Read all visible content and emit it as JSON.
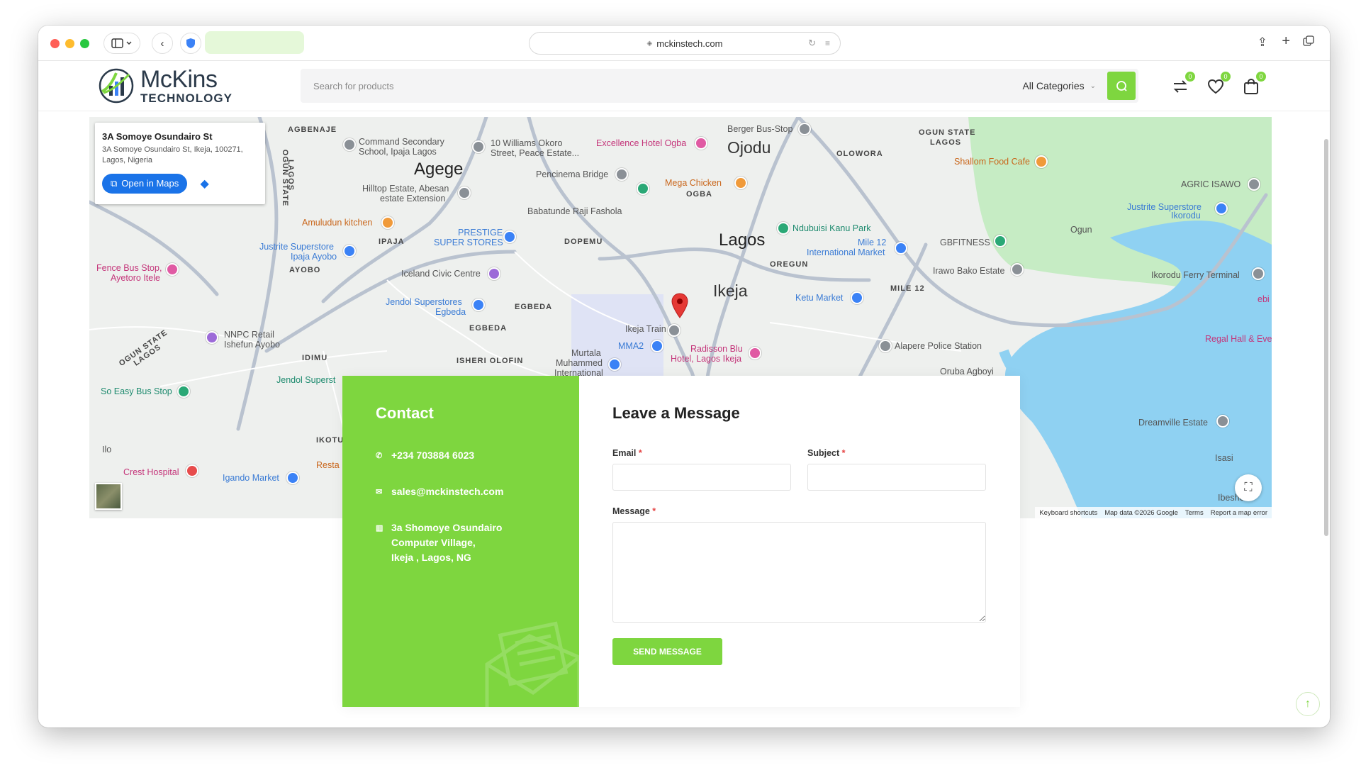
{
  "browser": {
    "url": "mckinstech.com"
  },
  "header": {
    "logo_word": "McKins",
    "logo_sub": "TECHNOLOGY",
    "search_placeholder": "Search for products",
    "category": "All Categories",
    "compare_count": "0",
    "wishlist_count": "0",
    "cart_count": "0"
  },
  "map": {
    "place_title": "3A Somoye Osundairo St",
    "place_address_line1": "3A Somoye Osundairo St, Ikeja, 100271,",
    "place_address_line2": "Lagos, Nigeria",
    "open_in_maps": "Open in Maps",
    "labels": {
      "agenaje": "AGBENAJE",
      "command": "Command Secondary",
      "command2": "School, Ipaja Lagos",
      "williams": "10 Williams Okoro",
      "williams2": "Street, Peace Estate...",
      "excellence": "Excellence Hotel Ogba",
      "berger": "Berger Bus-Stop",
      "ojodu": "Ojodu",
      "ogun_state": "OGUN STATE",
      "lagos_state": "LAGOS",
      "olowora": "OLOWORA",
      "shallom": "Shallom Food Cafe",
      "agege": "Agege",
      "pencinema": "Pencinema Bridge",
      "mega": "Mega Chicken",
      "ogba": "OGBA",
      "hilltop": "Hilltop Estate, Abesan",
      "hilltop2": "estate Extension",
      "babatunde": "Babatunde Raji Fashola",
      "agric": "AGRIC ISAWO",
      "justrite2": "Justrite Superstore",
      "justrite2b": "Ikorodu",
      "amuludun": "Amuludun kitchen",
      "ndubuisi": "Ndubuisi Kanu Park",
      "lagos": "Lagos",
      "prestige": "PRESTIGE",
      "prestige2": "SUPER STORES",
      "dopemu": "DOPEMU",
      "ipaja": "IPAJA",
      "ogun": "Ogun",
      "justrite": "Justrite Superstore",
      "justrite_b": "Ipaja Ayobo",
      "gbfitness": "GBFITNESS",
      "mile12market": "Mile 12",
      "intl_market": "International Market",
      "fence": "Fence Bus Stop,",
      "fence2": "Ayetoro Itele",
      "ayobo": "AYOBO",
      "iceland": "Iceland Civic Centre",
      "oregun": "OREGUN",
      "irawo": "Irawo Bako Estate",
      "ikorodu_ferry": "Ikorodu Ferry Terminal",
      "ikeja": "Ikeja",
      "ketu": "Ketu Market",
      "mile12": "MILE 12",
      "jendol": "Jendol Superstores",
      "jendol2": "Egbeda",
      "egbeda_caps": "EGBEDA",
      "egbeda": "EGBEDA",
      "ikeja_train": "Ikeja Train",
      "nnpc": "NNPC Retail",
      "nnpc2": "Ishefun Ayobo",
      "mma2": "MMA2",
      "regal": "Regal Hall & Eve",
      "alapere": "Alapere Police Station",
      "murtala": "Murtala",
      "murtala2": "Muhammed",
      "murtala3": "International",
      "radisson": "Radisson Blu",
      "radisson2": "Hotel, Lagos Ikeja",
      "idimu": "IDIMU",
      "isheri": "ISHERI OLOFIN",
      "oruba": "Oruba Agboyi",
      "so_easy": "So Easy Bus Stop",
      "jendol_b": "Jendol Superst",
      "dreamville": "Dreamville Estate",
      "ilo": "Ilo",
      "ikotu": "IKOTU",
      "isasi": "Isasi",
      "crest": "Crest Hospital",
      "igando": "Igando Market",
      "resta": "Resta",
      "ibeshe": "Ibeshe",
      "ogun_state_left": "OGUN STATE",
      "lagos_left": "LAGOS",
      "ogun_state_vert": "OGUN STATE",
      "lagos_vert": "LAGOS",
      "ebi": "ebi"
    },
    "footer": {
      "shortcuts": "Keyboard shortcuts",
      "data": "Map data ©2026 Google",
      "terms": "Terms",
      "report": "Report a map error"
    }
  },
  "contact": {
    "heading": "Contact",
    "phone": "+234 703884 6023",
    "email": "sales@mckinstech.com",
    "address_line1": "3a Shomoye Osundairo",
    "address_line2": "Computer Village,",
    "address_line3": "Ikeja , Lagos, NG"
  },
  "form": {
    "heading": "Leave a Message",
    "email_label": "Email",
    "subject_label": "Subject",
    "message_label": "Message",
    "required_mark": "*",
    "send_label": "SEND MESSAGE"
  },
  "colors": {
    "brand_green": "#7ed63f",
    "map_blue_water": "#8fd1f2",
    "map_green": "#c6ecc4"
  }
}
